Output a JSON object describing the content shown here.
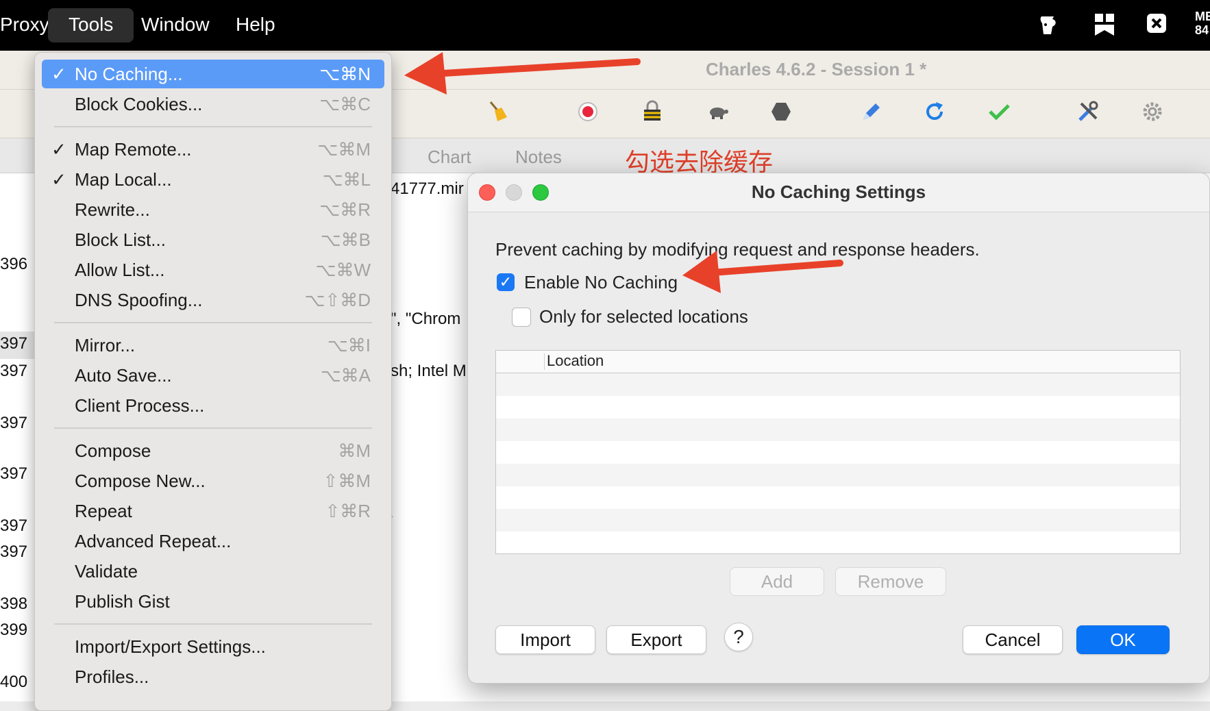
{
  "menubar": {
    "items": [
      "Proxy",
      "Tools",
      "Window",
      "Help"
    ],
    "active": "Tools",
    "tray_partial_text": "ME 84"
  },
  "window": {
    "title": "Charles 4.6.2 - Session 1 *",
    "tabs": [
      "Chart",
      "Notes"
    ],
    "toolbar_icons": [
      "broom-icon",
      "record-icon",
      "ssl-lock-icon",
      "throttle-turtle-icon",
      "breakpoint-hexagon-icon",
      "compose-pen-icon",
      "repeat-icon",
      "validate-check-icon",
      "tools-icon",
      "settings-gear-icon"
    ]
  },
  "annotation": {
    "text": "勾选去除缓存",
    "color": "#e0402a"
  },
  "background_fragments": {
    "line1": "41777.mir",
    "line2": "\", \"Chrom",
    "line3": "sh; Intel M",
    "line4": "/",
    "left_numbers": [
      "396",
      "397",
      "397",
      "397",
      "397",
      "397",
      "397",
      "398",
      "399",
      "400"
    ]
  },
  "tools_menu": {
    "items": [
      {
        "label": "No Caching...",
        "shortcut": "⌥⌘N",
        "checked": true,
        "highlighted": true
      },
      {
        "label": "Block Cookies...",
        "shortcut": "⌥⌘C",
        "checked": false
      },
      {
        "label": "Map Remote...",
        "shortcut": "⌥⌘M",
        "checked": true
      },
      {
        "label": "Map Local...",
        "shortcut": "⌥⌘L",
        "checked": true
      },
      {
        "label": "Rewrite...",
        "shortcut": "⌥⌘R",
        "checked": false
      },
      {
        "label": "Block List...",
        "shortcut": "⌥⌘B",
        "checked": false
      },
      {
        "label": "Allow List...",
        "shortcut": "⌥⌘W",
        "checked": false
      },
      {
        "label": "DNS Spoofing...",
        "shortcut": "⌥⇧⌘D",
        "checked": false
      },
      {
        "label": "Mirror...",
        "shortcut": "⌥⌘I",
        "checked": false
      },
      {
        "label": "Auto Save...",
        "shortcut": "⌥⌘A",
        "checked": false
      },
      {
        "label": "Client Process...",
        "shortcut": "",
        "checked": false
      },
      {
        "label": "Compose",
        "shortcut": "⌘M",
        "checked": false
      },
      {
        "label": "Compose New...",
        "shortcut": "⇧⌘M",
        "checked": false
      },
      {
        "label": "Repeat",
        "shortcut": "⇧⌘R",
        "checked": false
      },
      {
        "label": "Advanced Repeat...",
        "shortcut": "",
        "checked": false
      },
      {
        "label": "Validate",
        "shortcut": "",
        "checked": false
      },
      {
        "label": "Publish Gist",
        "shortcut": "",
        "checked": false
      },
      {
        "label": "Import/Export Settings...",
        "shortcut": "",
        "checked": false
      },
      {
        "label": "Profiles...",
        "shortcut": "",
        "checked": false
      }
    ]
  },
  "dialog": {
    "title": "No Caching Settings",
    "description": "Prevent caching by modifying request and response headers.",
    "enable_checkbox": {
      "label": "Enable No Caching",
      "checked": true
    },
    "selected_checkbox": {
      "label": "Only for selected locations",
      "checked": false
    },
    "table": {
      "columns": [
        "Location"
      ],
      "rows": []
    },
    "buttons": {
      "add": "Add",
      "remove": "Remove",
      "import": "Import",
      "export": "Export",
      "help": "?",
      "cancel": "Cancel",
      "ok": "OK"
    }
  },
  "colors": {
    "accent_blue": "#0a74f7",
    "menu_highlight": "#5b9bf8",
    "arrow_red": "#e8412a"
  }
}
